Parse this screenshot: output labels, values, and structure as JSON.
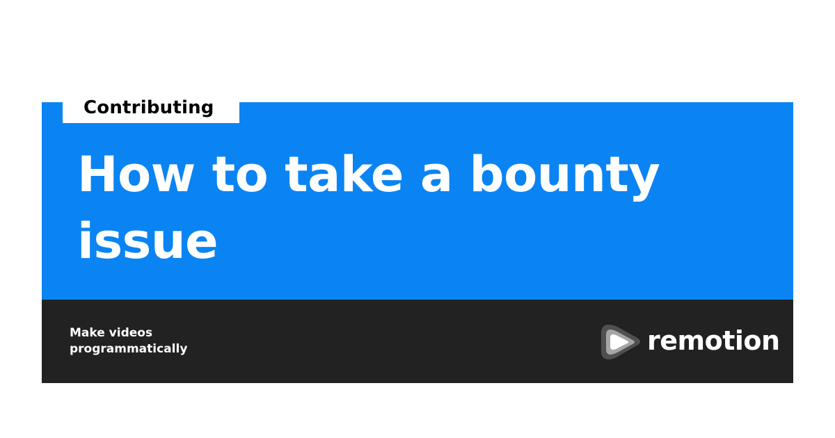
{
  "card": {
    "category": "Contributing",
    "title": "How to take a bounty issue",
    "tagline": [
      "Make videos",
      "programmatically"
    ],
    "brand": {
      "name": "remotion",
      "logo_icon": "remotion-play-logo-icon"
    }
  },
  "colors": {
    "accent_blue": "#0b84f3",
    "footer_dark": "#222222",
    "text_light": "#ffffff",
    "text_dark": "#000000"
  }
}
